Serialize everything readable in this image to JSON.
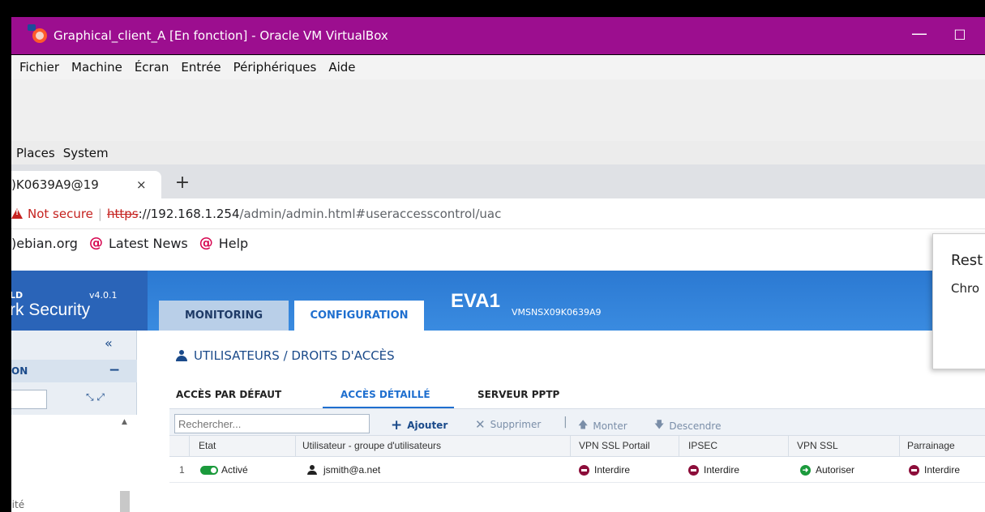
{
  "vbox": {
    "title": "Graphical_client_A [En fonction] - Oracle VM VirtualBox",
    "minimize": "—",
    "maximize": "☐",
    "menu": [
      "Fichier",
      "Machine",
      "Écran",
      "Entrée",
      "Périphériques",
      "Aide"
    ]
  },
  "gnome_panel": {
    "items": [
      "Places",
      "System"
    ]
  },
  "browser": {
    "tab_title": ")K0639A9@19",
    "tab_close": "×",
    "new_tab": "+",
    "not_secure": "Not secure",
    "separator": "|",
    "url_scheme": "https",
    "url_host": "://192.168.1.254",
    "url_path": "/admin/admin.html#useraccesscontrol/uac",
    "bookmarks": [
      {
        "icon": "debian-icon",
        "label": ")ebian.org",
        "has_icon": false
      },
      {
        "icon": "debian-icon",
        "label": "Latest News",
        "has_icon": true
      },
      {
        "icon": "debian-icon",
        "label": "Help",
        "has_icon": true
      }
    ]
  },
  "popup": {
    "title": "Rest",
    "subtitle": "Chro"
  },
  "app": {
    "brand_small": "LD",
    "version": "v4.0.1",
    "brand_big": "rk Security",
    "tabs": {
      "monitoring": "MONITORING",
      "configuration": "CONFIGURATION"
    },
    "fw_name": "EVA1",
    "fw_serial": "VMSNSX09K0639A9",
    "sidebar": {
      "collapse": "«",
      "section_label": "ON",
      "section_toggle": "−",
      "expand": "⤡ ⤢",
      "tree_item": "ilité"
    },
    "page_title": "UTILISATEURS / DROITS D'ACCÈS",
    "subtabs": [
      "ACCÈS PAR DÉFAUT",
      "ACCÈS DÉTAILLÉ",
      "SERVEUR PPTP"
    ],
    "toolbar": {
      "search_placeholder": "Rechercher...",
      "add": "Ajouter",
      "delete": "Supprimer",
      "separator": "|",
      "up": "Monter",
      "down": "Descendre"
    },
    "grid": {
      "columns": [
        "Etat",
        "Utilisateur - groupe d'utilisateurs",
        "VPN SSL Portail",
        "IPSEC",
        "VPN SSL",
        "Parrainage"
      ],
      "rows": [
        {
          "index": "1",
          "etat": "Activé",
          "user": "jsmith@a.net",
          "vpn_ssl_portail": "Interdire",
          "ipsec": "Interdire",
          "vpn_ssl": "Autoriser",
          "parrainage": "Interdire"
        }
      ]
    }
  },
  "colors": {
    "vbox_titlebar": "#9c0e8f",
    "app_header": "#3a8be0",
    "accent": "#1f6fcf",
    "deny": "#8c0d3a",
    "allow": "#1b9a3c"
  }
}
